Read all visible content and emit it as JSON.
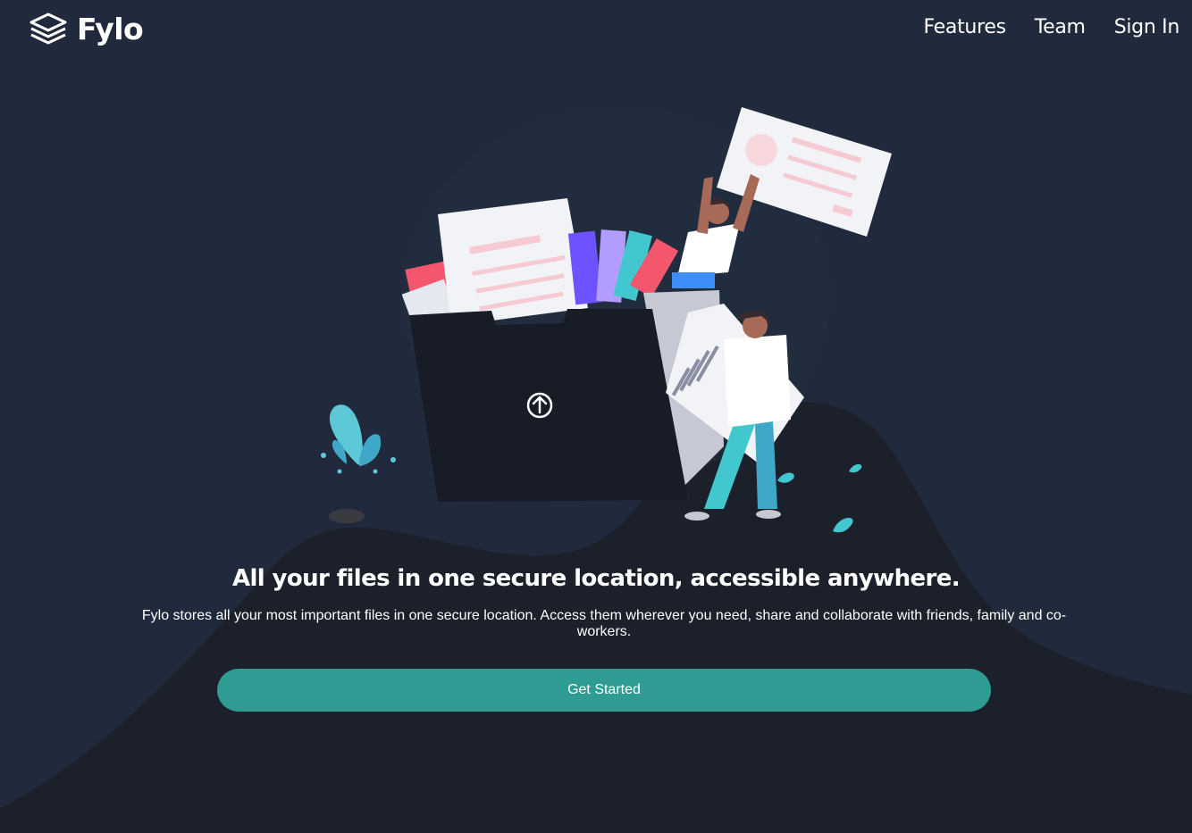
{
  "brand": {
    "name": "Fylo",
    "logo_icon": "layers-icon"
  },
  "nav": {
    "items": [
      {
        "label": "Features"
      },
      {
        "label": "Team"
      },
      {
        "label": "Sign In"
      }
    ]
  },
  "hero": {
    "illustration_icon": "upload-arrow-icon",
    "title": "All your files in one secure location, accessible anywhere.",
    "description": "Fylo stores all your most important files in one secure location. Access them wherever you need, share and collaborate with friends, family and co-workers.",
    "cta_label": "Get Started"
  },
  "colors": {
    "background": "#212a3d",
    "curve": "#1b202b",
    "accent": "#2e9c93",
    "text": "#ffffff"
  }
}
